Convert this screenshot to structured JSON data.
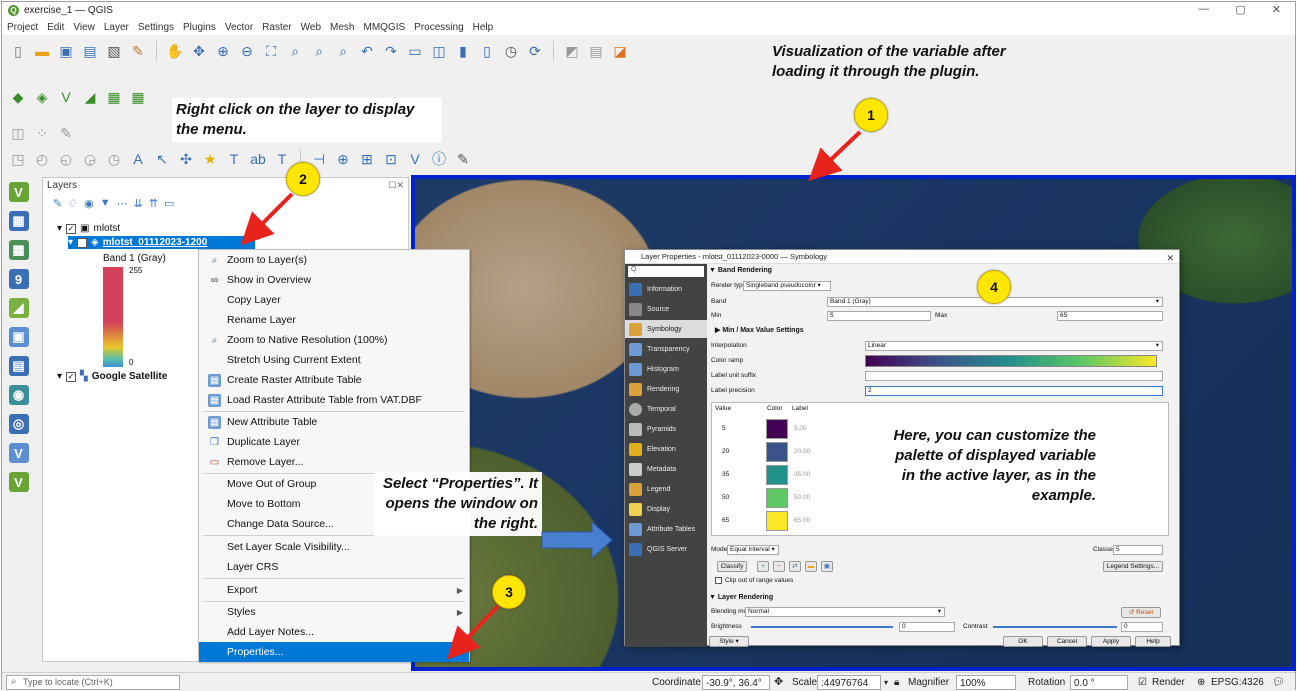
{
  "window": {
    "title": "exercise_1 — QGIS",
    "controls": [
      "—",
      "▢",
      "✕"
    ]
  },
  "menu": [
    "Project",
    "Edit",
    "View",
    "Layer",
    "Settings",
    "Plugins",
    "Vector",
    "Raster",
    "Web",
    "Mesh",
    "MMQGIS",
    "Processing",
    "Help"
  ],
  "layers_panel": {
    "title": "Layers",
    "group": "mlotst",
    "selected_layer": "mlotst_01112023-1200",
    "band_label": "Band 1 (Gray)",
    "max": "255",
    "min": "0",
    "basemap": "Google Satellite"
  },
  "context_menu": [
    {
      "label": "Zoom to Layer(s)",
      "icon": "zoom-icon"
    },
    {
      "label": "Show in Overview",
      "icon": "overview-icon"
    },
    {
      "label": "Copy Layer",
      "icon": ""
    },
    {
      "label": "Rename Layer",
      "icon": ""
    },
    {
      "label": "Zoom to Native Resolution (100%)",
      "icon": "native-res-icon"
    },
    {
      "label": "Stretch Using Current Extent",
      "icon": ""
    },
    {
      "label": "Create Raster Attribute Table",
      "icon": "table-icon"
    },
    {
      "label": "Load Raster Attribute Table from VAT.DBF",
      "icon": "table-icon"
    },
    {
      "label": "New Attribute Table",
      "icon": "table-icon"
    },
    {
      "label": "Duplicate Layer",
      "icon": "duplicate-icon"
    },
    {
      "label": "Remove Layer...",
      "icon": "remove-icon"
    },
    {
      "label": "Move Out of Group",
      "icon": ""
    },
    {
      "label": "Move to Bottom",
      "icon": ""
    },
    {
      "label": "Change Data Source...",
      "icon": ""
    },
    {
      "label": "Set Layer Scale Visibility...",
      "icon": ""
    },
    {
      "label": "Layer CRS",
      "icon": ""
    },
    {
      "label": "Export",
      "icon": ""
    },
    {
      "label": "Styles",
      "icon": ""
    },
    {
      "label": "Add Layer Notes...",
      "icon": ""
    },
    {
      "label": "Properties...",
      "icon": ""
    }
  ],
  "dialog": {
    "title": "Layer Properties - mlotst_01112023-0000 — Symbology",
    "sidebar": [
      "Information",
      "Source",
      "Symbology",
      "Transparency",
      "Histogram",
      "Rendering",
      "Temporal",
      "Pyramids",
      "Elevation",
      "Metadata",
      "Legend",
      "Display",
      "Attribute Tables",
      "QGIS Server"
    ],
    "search_placeholder": "Q",
    "band_rendering": "Band Rendering",
    "render_type_label": "Render type",
    "render_type": "Singleband pseudocolor",
    "band_label": "Band",
    "band_value": "Band 1 (Gray)",
    "min_label": "Min",
    "min_value": "5",
    "max_label": "Max",
    "max_value": "65",
    "minmax_settings": "Min / Max Value Settings",
    "interpolation_label": "Interpolation",
    "interpolation": "Linear",
    "color_ramp_label": "Color ramp",
    "label_suffix_label": "Label unit suffix",
    "label_precision_label": "Label precision",
    "label_precision": "2",
    "col_value": "Value",
    "col_color": "Color",
    "col_label": "Label",
    "classes": [
      {
        "value": "5",
        "label": "5.00",
        "color": "#440154"
      },
      {
        "value": "20",
        "label": "20.00",
        "color": "#3b528b"
      },
      {
        "value": "35",
        "label": "35.00",
        "color": "#21918c"
      },
      {
        "value": "50",
        "label": "50.00",
        "color": "#5ec962"
      },
      {
        "value": "65",
        "label": "65.00",
        "color": "#fde725"
      }
    ],
    "mode_label": "Mode",
    "mode": "Equal Interval",
    "classes_label": "Classes",
    "classes_count": "5",
    "classify": "Classify",
    "legend_settings": "Legend Settings...",
    "clip": "Clip out of range values",
    "layer_rendering": "Layer Rendering",
    "blending_label": "Blending mode",
    "blending": "Normal",
    "reset": "Reset",
    "brightness_label": "Brightness",
    "brightness": "0",
    "contrast_label": "Contrast",
    "contrast": "0",
    "style": "Style",
    "ok": "OK",
    "cancel": "Cancel",
    "apply": "Apply",
    "help": "Help"
  },
  "annotations": {
    "note1": "Visualization of the variable after loading it through the plugin.",
    "note2": "Right click on the layer to display the menu.",
    "note3": "Select “Properties”. It opens the window on the right.",
    "note4": "Here, you can customize the palette of displayed variable in the active layer, as in the example.",
    "badges": [
      "1",
      "2",
      "3",
      "4"
    ]
  },
  "statusbar": {
    "locate_placeholder": "Type to locate (Ctrl+K)",
    "coordinate_label": "Coordinate",
    "coordinate": "-30.9°, 36.4°",
    "scale_label": "Scale",
    "scale": ":44976764",
    "magnifier_label": "Magnifier",
    "magnifier": "100%",
    "rotation_label": "Rotation",
    "rotation": "0.0 °",
    "render": "Render",
    "crs": "EPSG:4326"
  },
  "colors": {
    "accent_blue": "#0022cc",
    "badge_yellow": "#ffe600",
    "arrow_red": "#e8231c",
    "selection": "#0078d7"
  }
}
